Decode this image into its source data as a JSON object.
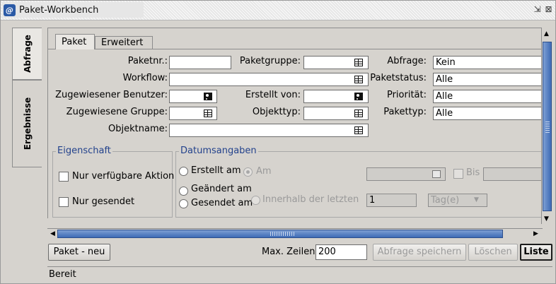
{
  "window": {
    "title": "Paket-Workbench",
    "restore_icon": "restore-icon",
    "close_icon": "close-icon"
  },
  "side_tabs": {
    "abfrage": "Abfrage",
    "ergebnisse": "Ergebnisse"
  },
  "panel_tabs": {
    "paket": "Paket",
    "erweitert": "Erweitert"
  },
  "form": {
    "paketnr_label": "Paketnr.:",
    "paketgruppe_label": "Paketgruppe:",
    "abfrage_label": "Abfrage:",
    "abfrage_value": "Kein",
    "workflow_label": "Workflow:",
    "paketstatus_label": "Paketstatus:",
    "paketstatus_value": "Alle",
    "zugewiesener_benutzer_label": "Zugewiesener Benutzer:",
    "erstellt_von_label": "Erstellt von:",
    "prioritaet_label": "Priorität:",
    "prioritaet_value": "Alle",
    "zugewiesene_gruppe_label": "Zugewiesene Gruppe:",
    "objekttyp_label": "Objekttyp:",
    "pakettyp_label": "Pakettyp:",
    "pakettyp_value": "Alle",
    "objektname_label": "Objektname:"
  },
  "eigenschaft": {
    "title": "Eigenschaft",
    "nur_verfuegbare": "Nur verfügbare Aktion",
    "nur_gesendet": "Nur gesendet"
  },
  "datum": {
    "title": "Datumsangaben",
    "erstellt_am": "Erstellt am",
    "geaendert_am": "Geändert am",
    "gesendet_am": "Gesendet am",
    "am": "Am",
    "innerhalb": "Innerhalb der letzten",
    "innerhalb_value": "1",
    "einheit": "Tag(e)",
    "bis": "Bis"
  },
  "bottom": {
    "paket_neu": "Paket - neu",
    "max_zeilen_label": "Max. Zeilen",
    "max_zeilen_value": "200",
    "speichern": "Abfrage speichern",
    "loeschen": "Löschen",
    "liste": "Liste"
  },
  "status": {
    "text": "Bereit"
  },
  "colors": {
    "accent_blue": "#3e6bb6",
    "group_title": "#23428c",
    "panel_bg": "#d6d3ce"
  }
}
